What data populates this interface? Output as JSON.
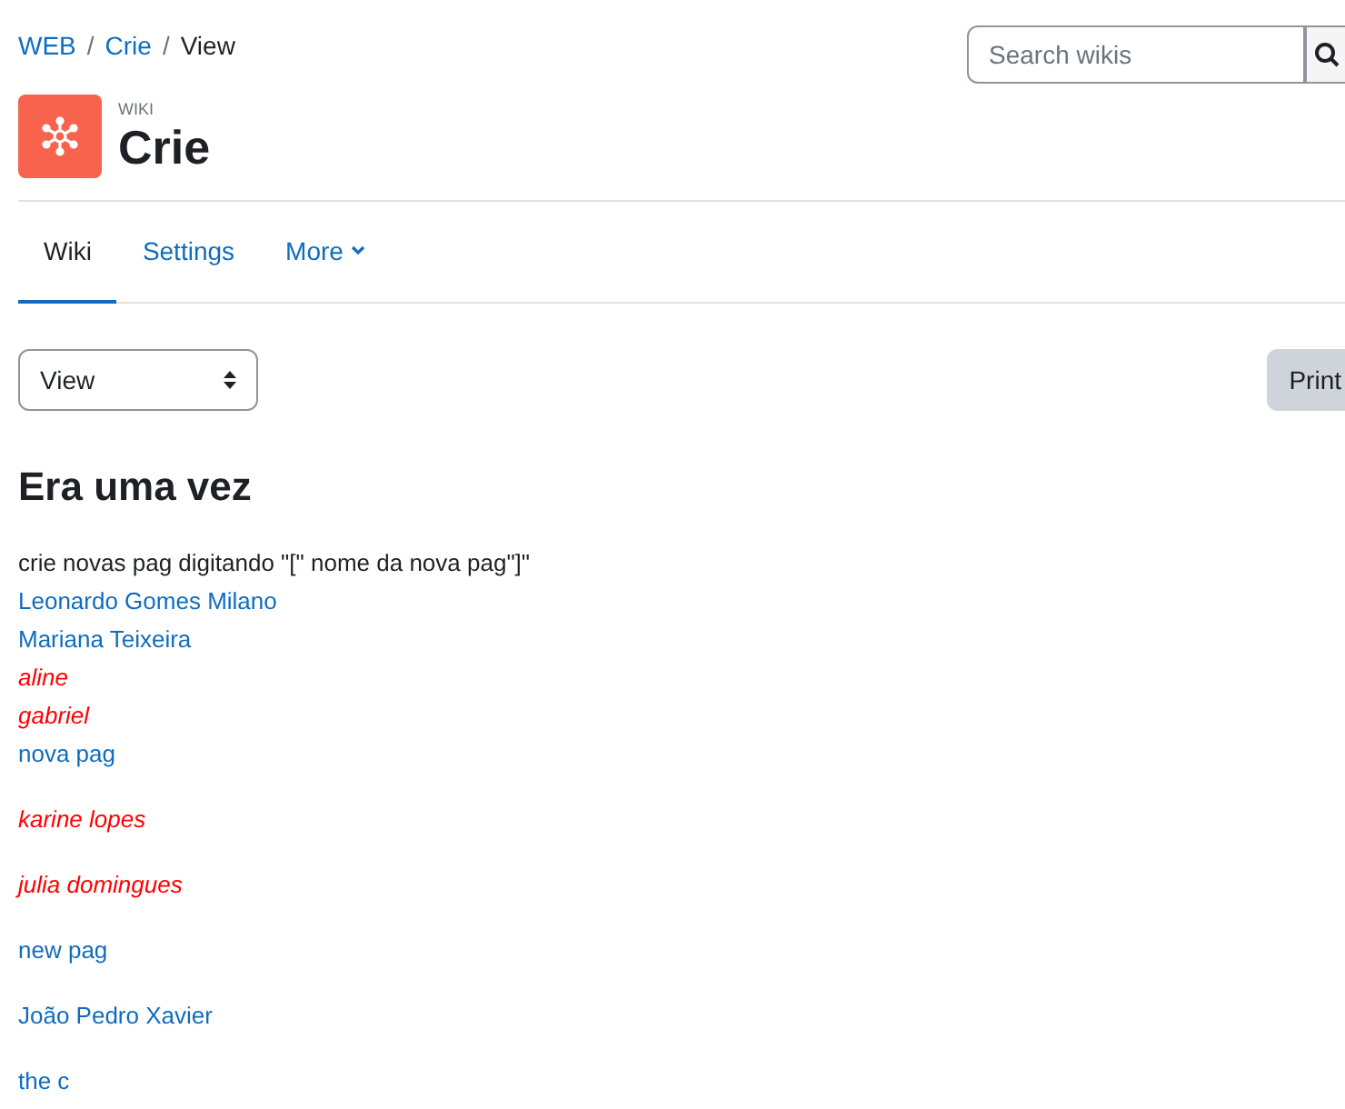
{
  "breadcrumb": [
    {
      "label": "WEB",
      "kind": "link"
    },
    {
      "label": "Crie",
      "kind": "link"
    },
    {
      "label": "View",
      "kind": "current"
    }
  ],
  "breadcrumb_separator": "/",
  "search": {
    "placeholder": "Search wikis"
  },
  "header": {
    "eyebrow": "WIKI",
    "title": "Crie"
  },
  "tabs": [
    {
      "label": "Wiki",
      "selected": true,
      "dropdown": false
    },
    {
      "label": "Settings",
      "selected": false,
      "dropdown": false
    },
    {
      "label": "More",
      "selected": false,
      "dropdown": true
    }
  ],
  "view_select": {
    "value": "View"
  },
  "print_button": "Print",
  "page": {
    "heading": "Era uma vez",
    "paragraphs": [
      [
        {
          "kind": "text",
          "label": "crie novas pag digitando \"[\"  nome da nova pag\"]\""
        },
        {
          "kind": "link",
          "label": "Leonardo Gomes Milano"
        },
        {
          "kind": "link",
          "label": "Mariana Teixeira"
        },
        {
          "kind": "missing",
          "label": "aline"
        },
        {
          "kind": "missing",
          "label": "gabriel"
        },
        {
          "kind": "link",
          "label": "nova pag"
        }
      ],
      [
        {
          "kind": "missing",
          "label": "karine lopes"
        }
      ],
      [
        {
          "kind": "missing",
          "label": "julia domingues"
        }
      ],
      [
        {
          "kind": "link",
          "label": "new pag"
        }
      ],
      [
        {
          "kind": "link",
          "label": "João Pedro Xavier"
        }
      ],
      [
        {
          "kind": "link",
          "label": "the c"
        }
      ]
    ]
  }
}
